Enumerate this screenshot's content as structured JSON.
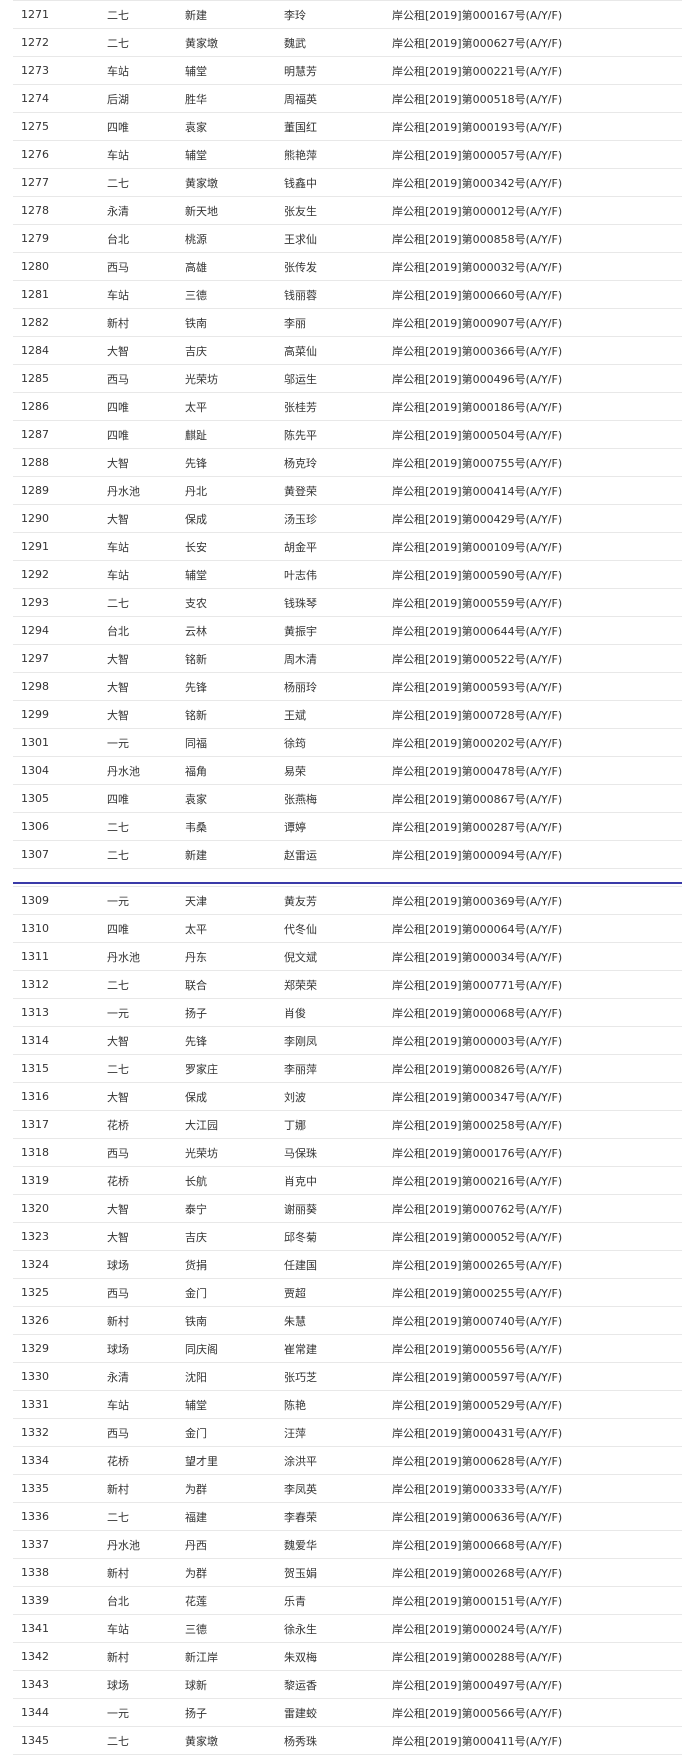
{
  "blocks": [
    {
      "rows": [
        [
          "1271",
          "二七",
          "新建",
          "李玲",
          "岸公租[2019]第000167号(A/Y/F)"
        ],
        [
          "1272",
          "二七",
          "黄家墩",
          "魏武",
          "岸公租[2019]第000627号(A/Y/F)"
        ],
        [
          "1273",
          "车站",
          "辅堂",
          "明慧芳",
          "岸公租[2019]第000221号(A/Y/F)"
        ],
        [
          "1274",
          "后湖",
          "胜华",
          "周福英",
          "岸公租[2019]第000518号(A/Y/F)"
        ],
        [
          "1275",
          "四唯",
          "袁家",
          "董国红",
          "岸公租[2019]第000193号(A/Y/F)"
        ],
        [
          "1276",
          "车站",
          "辅堂",
          "熊艳萍",
          "岸公租[2019]第000057号(A/Y/F)"
        ],
        [
          "1277",
          "二七",
          "黄家墩",
          "钱鑫中",
          "岸公租[2019]第000342号(A/Y/F)"
        ],
        [
          "1278",
          "永清",
          "新天地",
          "张友生",
          "岸公租[2019]第000012号(A/Y/F)"
        ],
        [
          "1279",
          "台北",
          "桃源",
          "王求仙",
          "岸公租[2019]第000858号(A/Y/F)"
        ],
        [
          "1280",
          "西马",
          "高雄",
          "张传发",
          "岸公租[2019]第000032号(A/Y/F)"
        ],
        [
          "1281",
          "车站",
          "三德",
          "钱丽蓉",
          "岸公租[2019]第000660号(A/Y/F)"
        ],
        [
          "1282",
          "新村",
          "铁南",
          "李丽",
          "岸公租[2019]第000907号(A/Y/F)"
        ],
        [
          "1284",
          "大智",
          "吉庆",
          "高菜仙",
          "岸公租[2019]第000366号(A/Y/F)"
        ],
        [
          "1285",
          "西马",
          "光荣坊",
          "邬运生",
          "岸公租[2019]第000496号(A/Y/F)"
        ],
        [
          "1286",
          "四唯",
          "太平",
          "张桂芳",
          "岸公租[2019]第000186号(A/Y/F)"
        ],
        [
          "1287",
          "四唯",
          "麒趾",
          "陈先平",
          "岸公租[2019]第000504号(A/Y/F)"
        ],
        [
          "1288",
          "大智",
          "先锋",
          "杨克玲",
          "岸公租[2019]第000755号(A/Y/F)"
        ],
        [
          "1289",
          "丹水池",
          "丹北",
          "黄登荣",
          "岸公租[2019]第000414号(A/Y/F)"
        ],
        [
          "1290",
          "大智",
          "保成",
          "汤玉珍",
          "岸公租[2019]第000429号(A/Y/F)"
        ],
        [
          "1291",
          "车站",
          "长安",
          "胡金平",
          "岸公租[2019]第000109号(A/Y/F)"
        ],
        [
          "1292",
          "车站",
          "辅堂",
          "叶志伟",
          "岸公租[2019]第000590号(A/Y/F)"
        ],
        [
          "1293",
          "二七",
          "支农",
          "钱珠琴",
          "岸公租[2019]第000559号(A/Y/F)"
        ],
        [
          "1294",
          "台北",
          "云林",
          "黄振宇",
          "岸公租[2019]第000644号(A/Y/F)"
        ],
        [
          "1297",
          "大智",
          "铭新",
          "周木清",
          "岸公租[2019]第000522号(A/Y/F)"
        ],
        [
          "1298",
          "大智",
          "先锋",
          "杨丽玲",
          "岸公租[2019]第000593号(A/Y/F)"
        ],
        [
          "1299",
          "大智",
          "铭新",
          "王斌",
          "岸公租[2019]第000728号(A/Y/F)"
        ],
        [
          "1301",
          "一元",
          "同福",
          "徐筠",
          "岸公租[2019]第000202号(A/Y/F)"
        ],
        [
          "1304",
          "丹水池",
          "福角",
          "易荣",
          "岸公租[2019]第000478号(A/Y/F)"
        ],
        [
          "1305",
          "四唯",
          "袁家",
          "张燕梅",
          "岸公租[2019]第000867号(A/Y/F)"
        ],
        [
          "1306",
          "二七",
          "韦桑",
          "谭婷",
          "岸公租[2019]第000287号(A/Y/F)"
        ],
        [
          "1307",
          "二七",
          "新建",
          "赵雷运",
          "岸公租[2019]第000094号(A/Y/F)"
        ]
      ]
    },
    {
      "rows": [
        [
          "1309",
          "一元",
          "天津",
          "黄友芳",
          "岸公租[2019]第000369号(A/Y/F)"
        ],
        [
          "1310",
          "四唯",
          "太平",
          "代冬仙",
          "岸公租[2019]第000064号(A/Y/F)"
        ],
        [
          "1311",
          "丹水池",
          "丹东",
          "倪文斌",
          "岸公租[2019]第000034号(A/Y/F)"
        ],
        [
          "1312",
          "二七",
          "联合",
          "郑荣荣",
          "岸公租[2019]第000771号(A/Y/F)"
        ],
        [
          "1313",
          "一元",
          "扬子",
          "肖俊",
          "岸公租[2019]第000068号(A/Y/F)"
        ],
        [
          "1314",
          "大智",
          "先锋",
          "李刚凤",
          "岸公租[2019]第000003号(A/Y/F)"
        ],
        [
          "1315",
          "二七",
          "罗家庄",
          "李丽萍",
          "岸公租[2019]第000826号(A/Y/F)"
        ],
        [
          "1316",
          "大智",
          "保成",
          "刘波",
          "岸公租[2019]第000347号(A/Y/F)"
        ],
        [
          "1317",
          "花桥",
          "大江园",
          "丁娜",
          "岸公租[2019]第000258号(A/Y/F)"
        ],
        [
          "1318",
          "西马",
          "光荣坊",
          "马保珠",
          "岸公租[2019]第000176号(A/Y/F)"
        ],
        [
          "1319",
          "花桥",
          "长航",
          "肖克中",
          "岸公租[2019]第000216号(A/Y/F)"
        ],
        [
          "1320",
          "大智",
          "泰宁",
          "谢丽葵",
          "岸公租[2019]第000762号(A/Y/F)"
        ],
        [
          "1323",
          "大智",
          "吉庆",
          "邱冬菊",
          "岸公租[2019]第000052号(A/Y/F)"
        ],
        [
          "1324",
          "球场",
          "货捐",
          "任建国",
          "岸公租[2019]第000265号(A/Y/F)"
        ],
        [
          "1325",
          "西马",
          "金门",
          "贾超",
          "岸公租[2019]第000255号(A/Y/F)"
        ],
        [
          "1326",
          "新村",
          "铁南",
          "朱慧",
          "岸公租[2019]第000740号(A/Y/F)"
        ],
        [
          "1329",
          "球场",
          "同庆阁",
          "崔常建",
          "岸公租[2019]第000556号(A/Y/F)"
        ],
        [
          "1330",
          "永清",
          "沈阳",
          "张巧芝",
          "岸公租[2019]第000597号(A/Y/F)"
        ],
        [
          "1331",
          "车站",
          "辅堂",
          "陈艳",
          "岸公租[2019]第000529号(A/Y/F)"
        ],
        [
          "1332",
          "西马",
          "金门",
          "汪萍",
          "岸公租[2019]第000431号(A/Y/F)"
        ],
        [
          "1334",
          "花桥",
          "望才里",
          "涂洪平",
          "岸公租[2019]第000628号(A/Y/F)"
        ],
        [
          "1335",
          "新村",
          "为群",
          "李凤英",
          "岸公租[2019]第000333号(A/Y/F)"
        ],
        [
          "1336",
          "二七",
          "福建",
          "李春荣",
          "岸公租[2019]第000636号(A/Y/F)"
        ],
        [
          "1337",
          "丹水池",
          "丹西",
          "魏爱华",
          "岸公租[2019]第000668号(A/Y/F)"
        ],
        [
          "1338",
          "新村",
          "为群",
          "贺玉娟",
          "岸公租[2019]第000268号(A/Y/F)"
        ],
        [
          "1339",
          "台北",
          "花莲",
          "乐青",
          "岸公租[2019]第000151号(A/Y/F)"
        ],
        [
          "1341",
          "车站",
          "三德",
          "徐永生",
          "岸公租[2019]第000024号(A/Y/F)"
        ],
        [
          "1342",
          "新村",
          "新江岸",
          "朱双梅",
          "岸公租[2019]第000288号(A/Y/F)"
        ],
        [
          "1343",
          "球场",
          "球新",
          "黎运香",
          "岸公租[2019]第000497号(A/Y/F)"
        ],
        [
          "1344",
          "一元",
          "扬子",
          "雷建蛟",
          "岸公租[2019]第000566号(A/Y/F)"
        ],
        [
          "1345",
          "二七",
          "黄家墩",
          "杨秀珠",
          "岸公租[2019]第000411号(A/Y/F)"
        ]
      ]
    }
  ]
}
